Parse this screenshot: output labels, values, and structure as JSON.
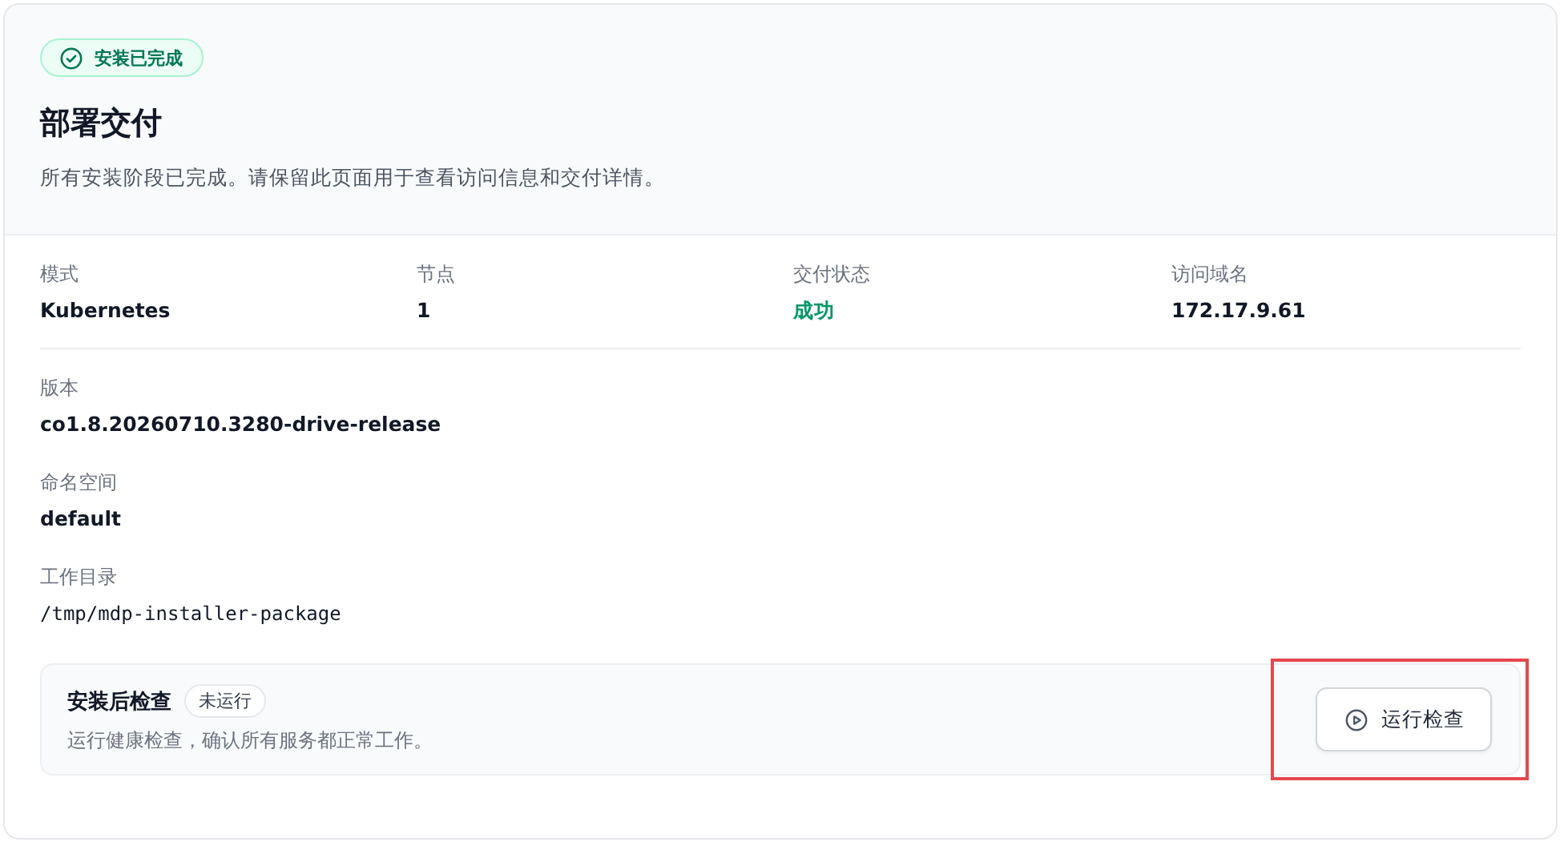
{
  "status_badge": {
    "text": "安装已完成",
    "kind": "success"
  },
  "title": "部署交付",
  "description": "所有安装阶段已完成。请保留此页面用于查看访问信息和交付详情。",
  "summary": [
    {
      "label": "模式",
      "value": "Kubernetes",
      "kind": "plain"
    },
    {
      "label": "节点",
      "value": "1",
      "kind": "plain"
    },
    {
      "label": "交付状态",
      "value": "成功",
      "kind": "success"
    },
    {
      "label": "访问域名",
      "value": "172.17.9.61",
      "kind": "plain"
    }
  ],
  "details": [
    {
      "label": "版本",
      "value": "co1.8.20260710.3280-drive-release",
      "kind": "plain"
    },
    {
      "label": "命名空间",
      "value": "default",
      "kind": "plain"
    },
    {
      "label": "工作目录",
      "value": "/tmp/mdp-installer-package",
      "kind": "mono"
    }
  ],
  "post_check": {
    "title": "安装后检查",
    "status": "未运行",
    "description": "运行健康检查，确认所有服务都正常工作。",
    "button": {
      "label": "运行检查",
      "highlighted": true
    }
  }
}
